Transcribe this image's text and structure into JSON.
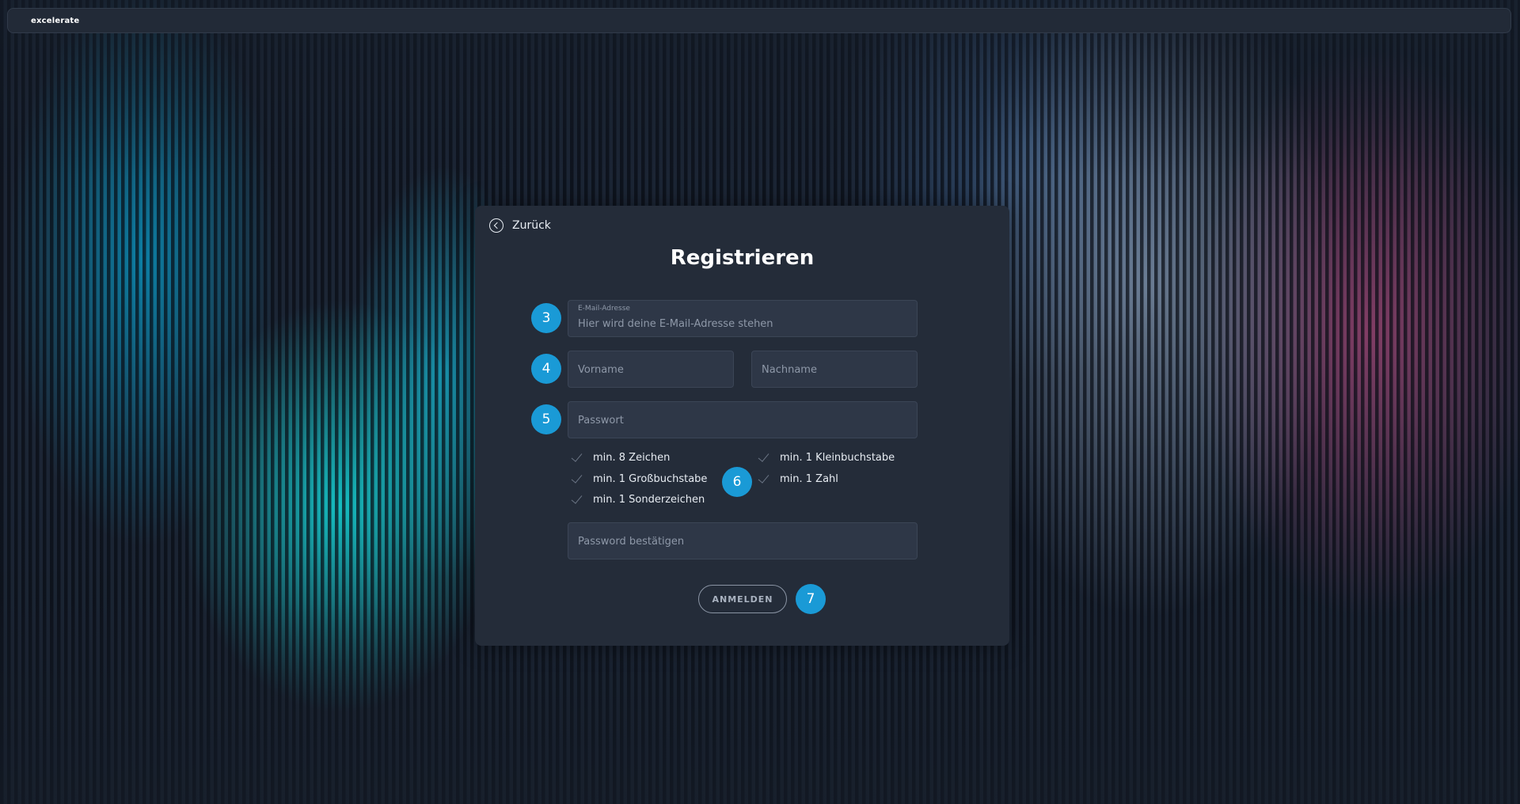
{
  "app": {
    "brand": "excelerate"
  },
  "card": {
    "back_label": "Zurück",
    "title": "Registrieren",
    "email": {
      "label": "E-Mail-Adresse",
      "placeholder": "Hier wird deine E-Mail-Adresse stehen",
      "value": ""
    },
    "first_name": {
      "placeholder": "Vorname",
      "value": ""
    },
    "last_name": {
      "placeholder": "Nachname",
      "value": ""
    },
    "password": {
      "placeholder": "Passwort",
      "value": ""
    },
    "password_rules": [
      {
        "label": "min. 8 Zeichen",
        "met": false
      },
      {
        "label": "min. 1 Großbuchstabe",
        "met": false
      },
      {
        "label": "min. 1 Sonderzeichen",
        "met": false
      },
      {
        "label": "min. 1 Kleinbuchstabe",
        "met": false
      },
      {
        "label": "min. 1 Zahl",
        "met": false
      }
    ],
    "confirm_password": {
      "placeholder": "Password bestätigen",
      "value": ""
    },
    "submit_label": "ANMELDEN"
  },
  "annotations": {
    "badges": [
      "3",
      "4",
      "5",
      "6",
      "7"
    ],
    "badge_color": "#1a9ad6"
  },
  "colors": {
    "card_bg": "#242c39",
    "field_bg": "#2e3747",
    "accent": "#1a9ad6"
  }
}
